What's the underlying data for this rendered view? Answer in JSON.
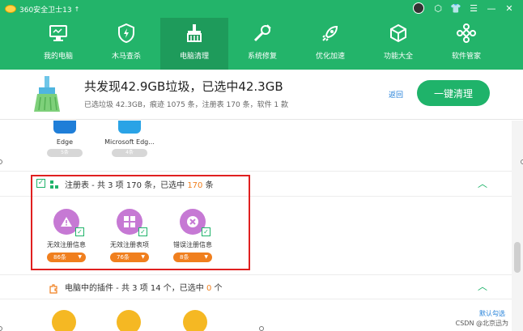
{
  "app": {
    "title": "360安全卫士13",
    "upgrade_glyph": "↑",
    "accent_color": "#23b46a"
  },
  "window_controls": [
    "⬡",
    "👕",
    "☰",
    "—",
    "✕"
  ],
  "nav": [
    {
      "label": "我的电脑",
      "icon": "monitor-icon"
    },
    {
      "label": "木马查杀",
      "icon": "shield-icon"
    },
    {
      "label": "电脑清理",
      "icon": "broom-icon",
      "active": true
    },
    {
      "label": "系统修复",
      "icon": "wrench-icon"
    },
    {
      "label": "优化加速",
      "icon": "rocket-icon"
    },
    {
      "label": "功能大全",
      "icon": "cube-icon"
    },
    {
      "label": "软件管家",
      "icon": "grid-flower-icon"
    }
  ],
  "summary": {
    "title": "共发现42.9GB垃圾，已选中42.3GB",
    "detail": "已选垃圾 42.3GB，痕迹 1075 条，注册表 170 条，软件 1 款",
    "back_label": "返回",
    "clean_label": "一键清理"
  },
  "previous_items": [
    {
      "label": "Edge",
      "count": "5条",
      "color": "#1f7ed8"
    },
    {
      "label": "Microsoft Edg...",
      "count": "4条",
      "color": "#2aa3e6"
    }
  ],
  "registry_section": {
    "title_prefix": "注册表 - 共 3 项 170 条，已选中 ",
    "selected": "170",
    "title_suffix": " 条",
    "caret": "︿",
    "items": [
      {
        "label": "无效注册信息",
        "count": "86条",
        "icon": "warning-icon"
      },
      {
        "label": "无效注册表项",
        "count": "76条",
        "icon": "windows-grid-icon"
      },
      {
        "label": "错误注册信息",
        "count": "8条",
        "icon": "error-x-icon"
      }
    ]
  },
  "plugin_section": {
    "title_prefix": "电脑中的插件 - 共 3 项 14 个，已选中 ",
    "selected": "0",
    "title_suffix": " 个",
    "caret": "︿"
  },
  "watermark": "CSDN @北京迅为",
  "watermark_link": "默认勾选"
}
